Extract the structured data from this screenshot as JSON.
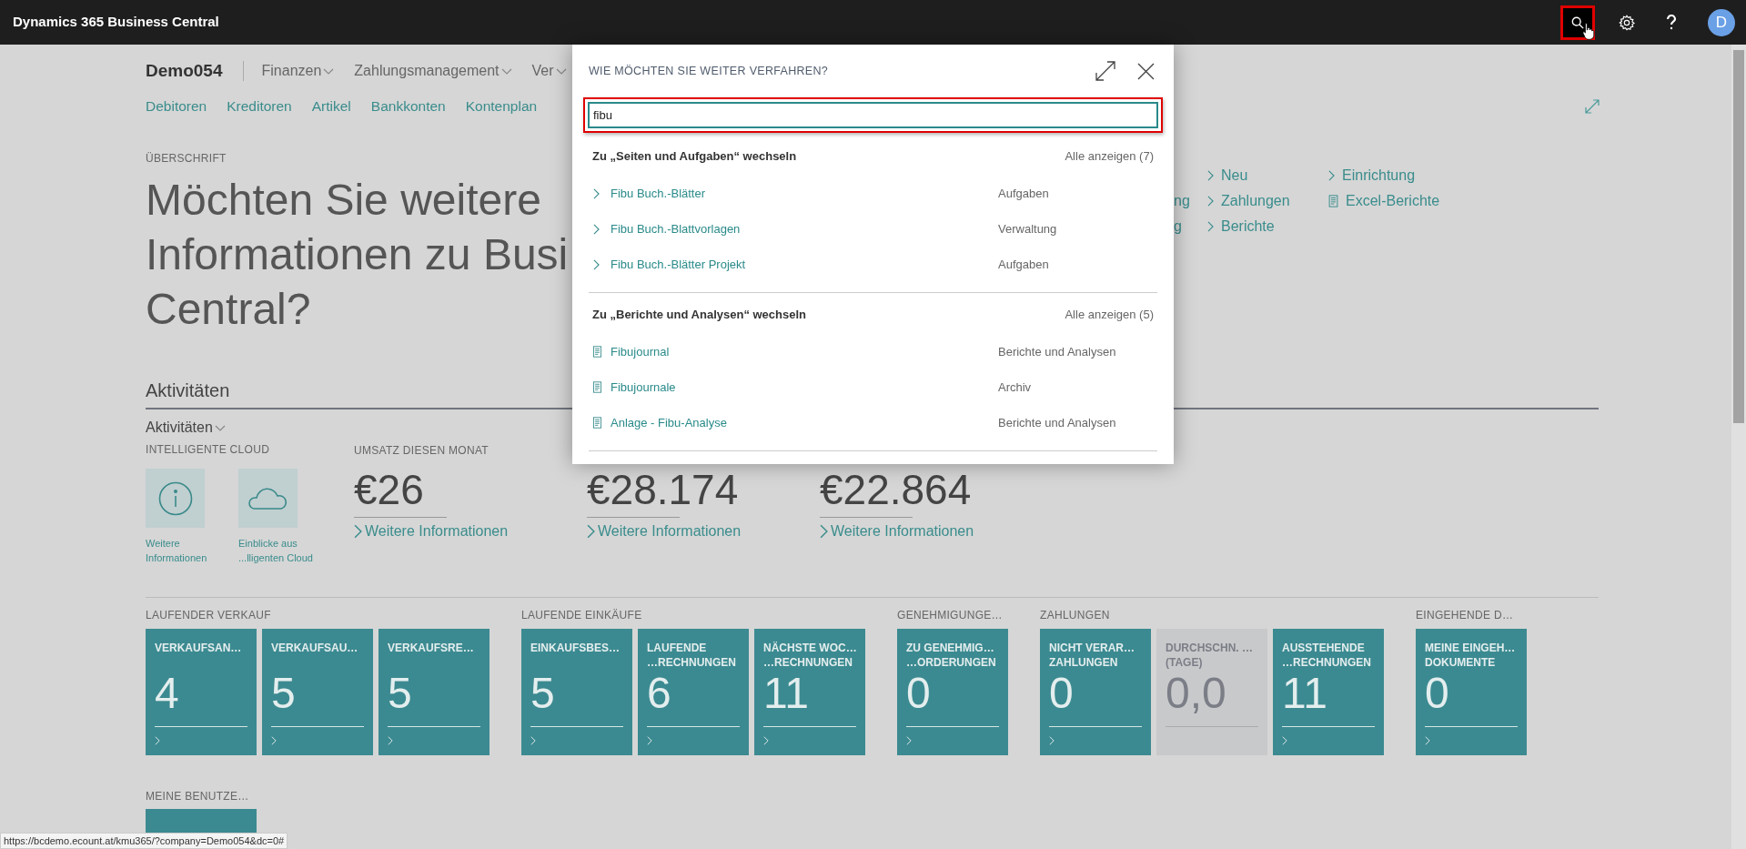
{
  "app_bar": {
    "title": "Dynamics 365 Business Central",
    "avatar": "D"
  },
  "company": "Demo054",
  "menus": [
    {
      "label": "Finanzen"
    },
    {
      "label": "Zahlungsmanagement"
    },
    {
      "label": "Ver"
    }
  ],
  "nav_links": [
    "Debitoren",
    "Kreditoren",
    "Artikel",
    "Bankkonten",
    "Kontenplan"
  ],
  "heading": {
    "caption": "ÜBERSCHRIFT",
    "lines": [
      "Möchten Sie weitere",
      "Informationen zu Busi",
      "Central?"
    ]
  },
  "action_columns": [
    {
      "items": [
        {
          "kind": "cut",
          "label": "ng"
        },
        {
          "kind": "cut",
          "label": "g"
        }
      ]
    },
    {
      "items": [
        {
          "kind": "page",
          "label": "Neu"
        },
        {
          "kind": "page",
          "label": "Zahlungen"
        },
        {
          "kind": "page",
          "label": "Berichte"
        }
      ]
    },
    {
      "items": [
        {
          "kind": "page",
          "label": "Einrichtung"
        },
        {
          "kind": "report",
          "label": "Excel-Berichte"
        }
      ]
    }
  ],
  "activities": {
    "title": "Aktivitäten",
    "group": "Aktivitäten",
    "cloud_caption": "INTELLIGENTE CLOUD",
    "cloud_tiles": [
      {
        "kind": "info",
        "label_lines": [
          "Weitere",
          "Informationen"
        ]
      },
      {
        "kind": "cloud",
        "label_lines": [
          "Einblicke aus",
          "...lligenten Cloud"
        ]
      }
    ],
    "kpis": [
      {
        "caption": "UMSATZ DIESEN MONAT",
        "value": "€26",
        "link": "Weitere Informationen"
      },
      {
        "value": "€28.174",
        "link": "Weitere Informationen"
      },
      {
        "value": "€22.864",
        "link": "Weitere Informationen"
      }
    ]
  },
  "tile_groups": [
    {
      "title": "LAUFENDER VERKAUF",
      "tiles": [
        {
          "title_lines": [
            "VERKAUFSAN…"
          ],
          "value": "4",
          "disabled": false
        },
        {
          "title_lines": [
            "VERKAUFSAU…"
          ],
          "value": "5",
          "disabled": false
        },
        {
          "title_lines": [
            "VERKAUFSRE…"
          ],
          "value": "5",
          "disabled": false
        }
      ]
    },
    {
      "title": "LAUFENDE EINKÄUFE",
      "tiles": [
        {
          "title_lines": [
            "EINKAUFSBES…"
          ],
          "value": "5",
          "disabled": false
        },
        {
          "title_lines": [
            "LAUFENDE",
            "…RECHNUNGEN"
          ],
          "value": "6",
          "disabled": false
        },
        {
          "title_lines": [
            "NÄCHSTE WOC…",
            "…RECHNUNGEN"
          ],
          "value": "11",
          "disabled": false
        }
      ]
    },
    {
      "title": "GENEHMIGUNGE…",
      "tiles": [
        {
          "title_lines": [
            "ZU GENEHMIG…",
            "…ORDERUNGEN"
          ],
          "value": "0",
          "disabled": false
        }
      ]
    },
    {
      "title": "ZAHLUNGEN",
      "tiles": [
        {
          "title_lines": [
            "NICHT VERAR…",
            "ZAHLUNGEN"
          ],
          "value": "0",
          "disabled": false
        },
        {
          "title_lines": [
            "DURCHSCHN. …",
            "(TAGE)"
          ],
          "value": "0,0",
          "disabled": true
        },
        {
          "title_lines": [
            "AUSSTEHENDE",
            "…RECHNUNGEN"
          ],
          "value": "11",
          "disabled": false
        }
      ]
    },
    {
      "title": "EINGEHENDE D…",
      "tiles": [
        {
          "title_lines": [
            "MEINE EINGEH…",
            "DOKUMENTE"
          ],
          "value": "0",
          "disabled": false
        }
      ]
    }
  ],
  "user_section": {
    "title": "MEINE BENUTZE…"
  },
  "dialog": {
    "title": "WIE MÖCHTEN SIE WEITER VERFAHREN?",
    "search_value": "fibu",
    "sections": [
      {
        "kind": "pages",
        "title": "Zu „Seiten und Aufgaben“ wechseln",
        "show_all": "Alle anzeigen (7)",
        "items": [
          {
            "label": "Fibu Buch.-Blätter",
            "category": "Aufgaben"
          },
          {
            "label": "Fibu Buch.-Blattvorlagen",
            "category": "Verwaltung"
          },
          {
            "label": "Fibu Buch.-Blätter Projekt",
            "category": "Aufgaben"
          }
        ]
      },
      {
        "kind": "reports",
        "title": "Zu „Berichte und Analysen“ wechseln",
        "show_all": "Alle anzeigen (5)",
        "items": [
          {
            "label": "Fibujournal",
            "category": "Berichte und Analysen"
          },
          {
            "label": "Fibujournale",
            "category": "Archiv"
          },
          {
            "label": "Anlage - Fibu-Analyse",
            "category": "Berichte und Analysen"
          }
        ]
      }
    ]
  },
  "status_url": "https://bcdemo.ecount.at/kmu365/?company=Demo054&dc=0#"
}
